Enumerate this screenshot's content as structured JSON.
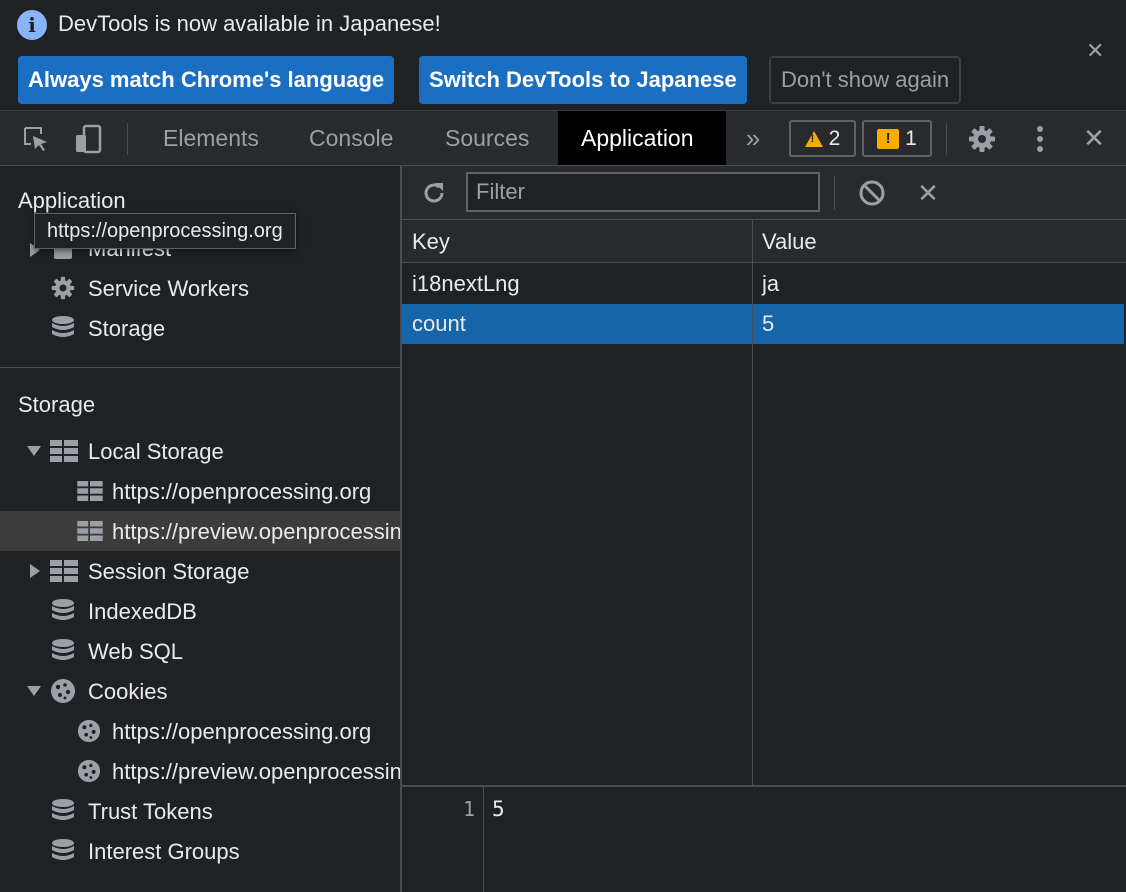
{
  "infobar": {
    "message": "DevTools is now available in Japanese!",
    "close_glyph": "✕",
    "buttons": {
      "match_language": "Always match Chrome's language",
      "switch_japanese": "Switch DevTools to Japanese",
      "dont_show": "Don't show again"
    }
  },
  "tabs": {
    "items": [
      "Elements",
      "Console",
      "Sources",
      "Application"
    ],
    "active": "Application",
    "more_glyph": "»",
    "warnings_count": "2",
    "issues_count": "1",
    "close_glyph": "✕"
  },
  "sidebar": {
    "application_title": "Application",
    "tooltip": "https://openprocessing.org",
    "manifest_label": "Manifest",
    "service_workers_label": "Service Workers",
    "storage_item_label": "Storage",
    "storage_title": "Storage",
    "local_storage": "Local Storage",
    "local_storage_items": [
      "https://openprocessing.org",
      "https://preview.openprocessing.org"
    ],
    "session_storage": "Session Storage",
    "indexeddb": "IndexedDB",
    "web_sql": "Web SQL",
    "cookies": "Cookies",
    "cookie_items": [
      "https://openprocessing.org",
      "https://preview.openprocessing.org"
    ],
    "trust_tokens": "Trust Tokens",
    "interest_groups": "Interest Groups"
  },
  "main": {
    "filter_placeholder": "Filter",
    "clear_glyph": "✕",
    "columns": {
      "key": "Key",
      "value": "Value"
    },
    "rows": [
      {
        "key": "i18nextLng",
        "value": "ja"
      },
      {
        "key": "count",
        "value": "5"
      }
    ],
    "selected_row": "count",
    "preview": {
      "line_number": "1",
      "content": "5"
    }
  },
  "colors": {
    "accent_blue": "#1b6fc2",
    "selected_row": "#1565a8",
    "warning": "#f9ab00"
  }
}
